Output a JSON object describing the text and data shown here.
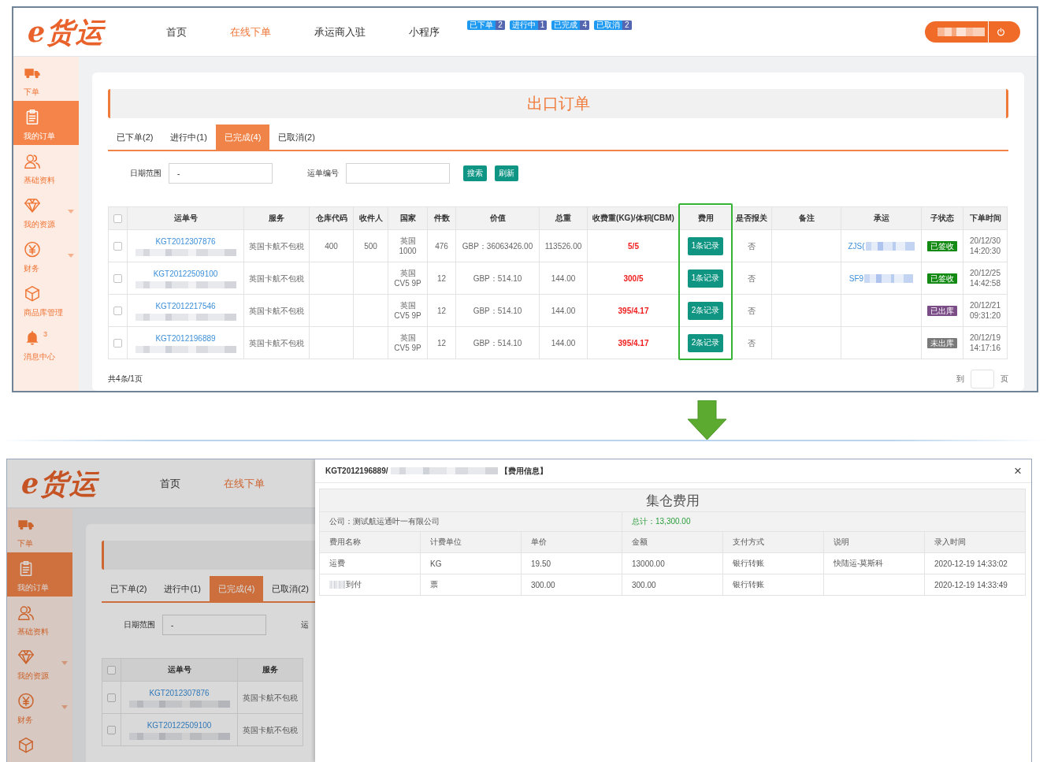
{
  "order_page": {
    "logo": "e货运",
    "nav": [
      {
        "label": "首页",
        "selected": false
      },
      {
        "label": "在线下单",
        "selected": true
      },
      {
        "label": "承运商入驻",
        "selected": false
      },
      {
        "label": "小程序",
        "selected": false
      }
    ],
    "status_badges": [
      {
        "label": "已下单",
        "count": "2"
      },
      {
        "label": "进行中",
        "count": "1"
      },
      {
        "label": "已完成",
        "count": "4"
      },
      {
        "label": "已取消",
        "count": "2"
      }
    ],
    "account": {
      "redacted": true
    },
    "sidebar": [
      {
        "label": "下单",
        "selected": false
      },
      {
        "label": "我的订单",
        "selected": true
      },
      {
        "label": "基础资料",
        "selected": false
      },
      {
        "label": "我的资源",
        "selected": false,
        "submenu": true
      },
      {
        "label": "财务",
        "selected": false,
        "submenu": true
      },
      {
        "label": "商品库管理",
        "selected": false
      },
      {
        "label": "消息中心",
        "selected": false,
        "count": "3"
      }
    ],
    "title": "出口订单",
    "tabs": [
      {
        "label": "已下单(2)",
        "selected": false
      },
      {
        "label": "进行中(1)",
        "selected": false
      },
      {
        "label": "已完成(4)",
        "selected": true
      },
      {
        "label": "已取消(2)",
        "selected": false
      }
    ],
    "filters": [
      {
        "label": "日期范围",
        "has_field": true,
        "value": "-"
      },
      {
        "label": "运单编号",
        "has_field": true
      }
    ],
    "filter_buttons": [
      "搜索",
      "刷新"
    ],
    "table": {
      "select_all": {
        "checked": false
      },
      "columns": [
        {
          "label": "运单号",
          "highlighted": false
        },
        {
          "label": "服务",
          "highlighted": false
        },
        {
          "label": "仓库代码",
          "highlighted": false
        },
        {
          "label": "收件人",
          "highlighted": false
        },
        {
          "label": "国家",
          "highlighted": false
        },
        {
          "label": "件数",
          "highlighted": false
        },
        {
          "label": "价值",
          "highlighted": false
        },
        {
          "label": "总重",
          "highlighted": false
        },
        {
          "label": "收费重(KG)/体积(CBM)",
          "highlighted": false
        },
        {
          "label": "费用",
          "highlighted": true
        },
        {
          "label": "是否报关",
          "highlighted": false
        },
        {
          "label": "备注",
          "highlighted": false
        },
        {
          "label": "承运",
          "highlighted": false
        },
        {
          "label": "子状态",
          "highlighted": false
        },
        {
          "label": "下单时间",
          "highlighted": false
        }
      ],
      "rows": [
        {
          "checked": false,
          "waybill": "KGT2012307876",
          "waybill_note_redacted": true,
          "service": "英国卡航不包税",
          "warehouse_code": "400",
          "recipient": "500",
          "country": "英国",
          "postcode": "1000",
          "pieces": "476",
          "value": "GBP：36063426.00",
          "gross_weight": "113526.00",
          "chargeable": "5/5",
          "fees": "1条记录",
          "customs": "否",
          "carrier": {
            "text": "ZJS(",
            "redacted": true
          },
          "sub_status": {
            "label": "已签收",
            "color": "#138a13"
          },
          "order_date": "20/12/30",
          "order_time": "14:20:30"
        },
        {
          "checked": false,
          "waybill": "KGT20122509100",
          "waybill_note_redacted": true,
          "service": "英国卡航不包税",
          "country": "英国",
          "postcode": "CV5 9P",
          "pieces": "12",
          "value": "GBP：514.10",
          "gross_weight": "144.00",
          "chargeable": "300/5",
          "fees": "1条记录",
          "customs": "否",
          "carrier": {
            "text": "SF9",
            "redacted": true
          },
          "sub_status": {
            "label": "已签收",
            "color": "#138a13"
          },
          "order_date": "20/12/25",
          "order_time": "14:42:58"
        },
        {
          "checked": false,
          "waybill": "KGT2012217546",
          "waybill_note_redacted": true,
          "service": "英国卡航不包税",
          "country": "英国",
          "postcode": "CV5 9P",
          "pieces": "12",
          "value": "GBP：514.10",
          "gross_weight": "144.00",
          "chargeable": "395/4.17",
          "fees": "2条记录",
          "customs": "否",
          "sub_status": {
            "label": "已出库",
            "color": "#7b4d87"
          },
          "order_date": "20/12/21",
          "order_time": "09:31:20"
        },
        {
          "checked": false,
          "waybill": "KGT2012196889",
          "waybill_note_redacted": true,
          "service": "英国卡航不包税",
          "country": "英国",
          "postcode": "CV5 9P",
          "pieces": "12",
          "value": "GBP：514.10",
          "gross_weight": "144.00",
          "chargeable": "395/4.17",
          "fees": "2条记录",
          "customs": "否",
          "sub_status": {
            "label": "未出库",
            "color": "#7a7a7a"
          },
          "order_date": "20/12/19",
          "order_time": "14:17:16"
        }
      ]
    },
    "summary": "共4条/1页",
    "pager": {
      "before": "到",
      "after": "页"
    }
  },
  "background_page": {
    "dimmed": true,
    "logo": "e货运",
    "nav": [
      {
        "label": "首页",
        "selected": false
      },
      {
        "label": "在线下单",
        "selected": true
      }
    ],
    "sidebar": [
      {
        "label": "下单",
        "selected": false
      },
      {
        "label": "我的订单",
        "selected": true
      },
      {
        "label": "基础资料",
        "selected": false
      },
      {
        "label": "我的资源",
        "selected": false,
        "submenu": true
      },
      {
        "label": "财务",
        "selected": false,
        "submenu": true
      },
      {
        "selected": false
      }
    ],
    "tabs": [
      {
        "label": "已下单(2)",
        "selected": false
      },
      {
        "label": "进行中(1)",
        "selected": false
      },
      {
        "label": "已完成(4)",
        "selected": true
      },
      {
        "label": "已取消(2)",
        "selected": false
      }
    ],
    "filters": [
      {
        "label": "日期范围",
        "has_field": true,
        "value": "-"
      },
      {
        "label": "运"
      }
    ],
    "table": {
      "select_all": {
        "checked": false
      },
      "columns": [
        {
          "label": "运单号",
          "highlighted": false
        },
        {
          "label": "服务",
          "highlighted": false
        }
      ],
      "rows": [
        {
          "checked": false,
          "waybill": "KGT2012307876",
          "waybill_note_redacted": true,
          "service": "英国卡航不包税"
        },
        {
          "checked": false,
          "waybill": "KGT20122509100",
          "waybill_note_redacted": true,
          "service": "英国卡航不包税"
        }
      ]
    }
  },
  "fee_dialog": {
    "title": {
      "prefix": "KGT2012196889/",
      "redacted": true,
      "suffix": "【费用信息】"
    },
    "close": "×",
    "section_title": "集仓费用",
    "company": "公司：测试航运通叶一有限公司",
    "total": "总计：13,300.00",
    "columns": [
      "费用名称",
      "计费单位",
      "单价",
      "金额",
      "支付方式",
      "说明",
      "录入时间"
    ],
    "rows": [
      {
        "fee_name": "运费",
        "unit": "KG",
        "unit_price": "19.50",
        "amount": "13000.00",
        "payment": "银行转账",
        "note": "快陆运-莫斯科",
        "entered_at": "2020-12-19 14:33:02"
      },
      {
        "redacted_prefix": true,
        "fee_name": "到付",
        "unit": "票",
        "unit_price": "300.00",
        "amount": "300.00",
        "payment": "银行转账",
        "entered_at": "2020-12-19 14:33:49"
      }
    ]
  }
}
